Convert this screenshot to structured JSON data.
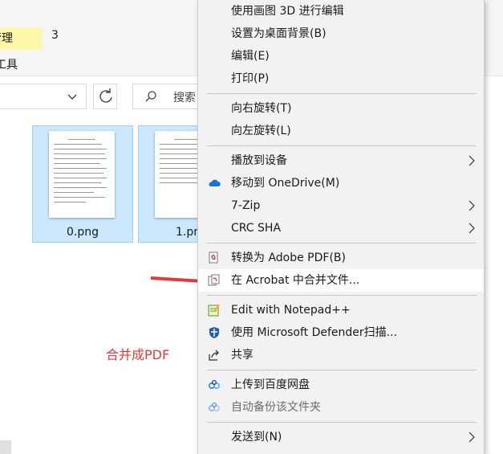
{
  "explorer": {
    "tab_manage": "管理",
    "tab_number": "3",
    "tools_label": "工具",
    "search_placeholder": "搜索",
    "files": [
      {
        "name": "0.png"
      },
      {
        "name": "1.png"
      }
    ]
  },
  "annotation": {
    "text": "合并成PDF",
    "color": "#e53935"
  },
  "context_menu": {
    "items": [
      {
        "label": "使用画图 3D 进行编辑"
      },
      {
        "label": "设置为桌面背景(B)"
      },
      {
        "label": "编辑(E)"
      },
      {
        "label": "打印(P)"
      },
      {
        "label": "向右旋转(T)"
      },
      {
        "label": "向左旋转(L)"
      },
      {
        "label": "播放到设备"
      },
      {
        "label": "移动到 OneDrive(M)"
      },
      {
        "label": "7-Zip"
      },
      {
        "label": "CRC SHA"
      },
      {
        "label": "转换为 Adobe PDF(B)"
      },
      {
        "label": "在 Acrobat 中合并文件..."
      },
      {
        "label": "Edit with Notepad++"
      },
      {
        "label": "使用 Microsoft Defender扫描..."
      },
      {
        "label": "共享"
      },
      {
        "label": "上传到百度网盘"
      },
      {
        "label": "自动备份该文件夹"
      },
      {
        "label": "发送到(N)"
      }
    ]
  },
  "colors": {
    "selection": "#cce8ff",
    "menu_bg": "#f2f2f2",
    "highlight_tab": "#fbf6a8"
  }
}
